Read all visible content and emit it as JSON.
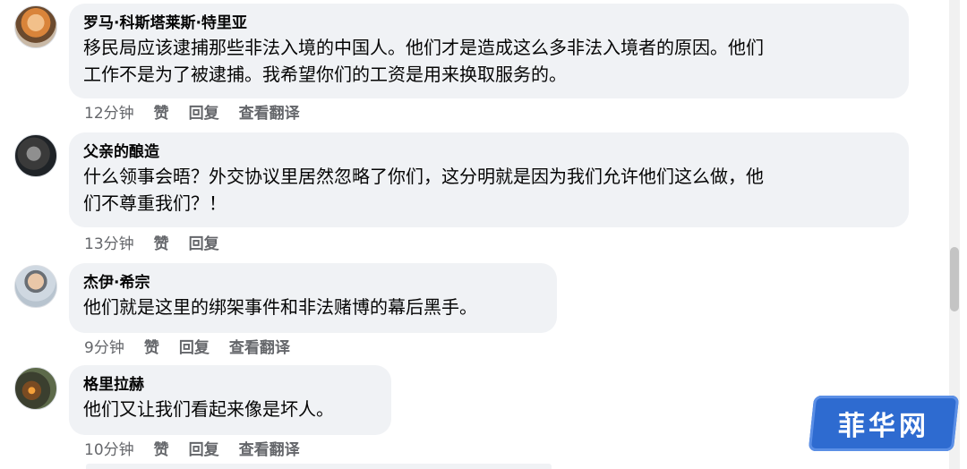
{
  "comments": [
    {
      "author": "罗马·科斯塔莱斯·特里亚",
      "text": "移民局应该逮捕那些非法入境的中国人。他们才是造成这么多非法入境者的原因。他们\n工作不是为了被逮捕。我希望你们的工资是用来换取服务的。",
      "time": "12分钟",
      "like": "赞",
      "reply": "回复",
      "translate": "查看翻译"
    },
    {
      "author": "父亲的酿造",
      "text": "什么领事会晤？外交协议里居然忽略了你们，这分明就是因为我们允许他们这么做，他\n们不尊重我们？！",
      "time": "13分钟",
      "like": "赞",
      "reply": "回复"
    },
    {
      "author": "杰伊·希宗",
      "text": "他们就是这里的绑架事件和非法赌博的幕后黑手。",
      "time": "9分钟",
      "like": "赞",
      "reply": "回复",
      "translate": "查看翻译"
    },
    {
      "author": "格里拉赫",
      "text": "他们又让我们看起来像是坏人。",
      "time": "10分钟",
      "like": "赞",
      "reply": "回复",
      "translate": "查看翻译"
    }
  ],
  "watermark": {
    "text": "菲华网",
    "color": "#2e6bd0"
  },
  "colors": {
    "bubble": "#f0f2f5",
    "meta": "#65676b"
  }
}
